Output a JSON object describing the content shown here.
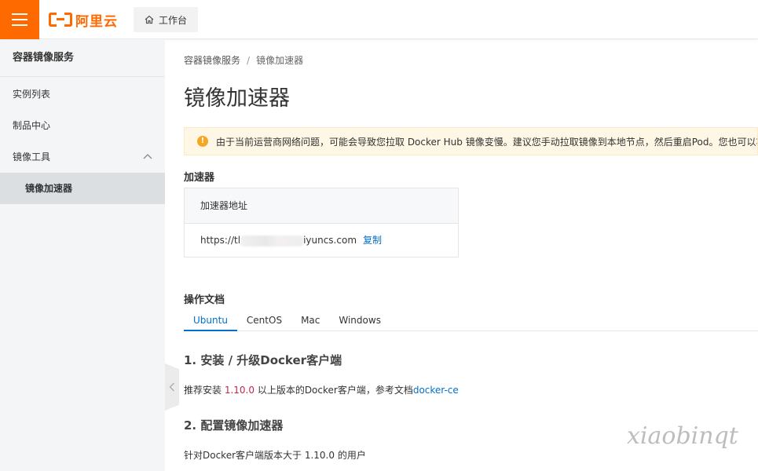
{
  "header": {
    "logo_text": "阿里云",
    "workbench_label": "工作台"
  },
  "sidebar": {
    "title": "容器镜像服务",
    "items": [
      {
        "label": "实例列表"
      },
      {
        "label": "制品中心"
      },
      {
        "label": "镜像工具",
        "expanded": true
      },
      {
        "label": "镜像加速器",
        "active": true
      }
    ]
  },
  "main": {
    "breadcrumb": {
      "parent": "容器镜像服务",
      "separator": "/",
      "current": "镜像加速器"
    },
    "title": "镜像加速器",
    "alert": "由于当前运营商网络问题，可能会导致您拉取 Docker Hub 镜像变慢。建议您手动拉取镜像到本地节点，然后重启Pod。您也可以将",
    "accelerator": {
      "section_title": "加速器",
      "column_header": "加速器地址",
      "url_prefix": "https://tl",
      "url_suffix": "iyuncs.com",
      "copy_label": "复制"
    },
    "docs": {
      "section_title": "操作文档",
      "tabs": [
        {
          "label": "Ubuntu",
          "active": true
        },
        {
          "label": "CentOS"
        },
        {
          "label": "Mac"
        },
        {
          "label": "Windows"
        }
      ],
      "step1": {
        "heading": "1. 安装 / 升级Docker客户端",
        "text_before": "推荐安装 ",
        "version": "1.10.0",
        "text_middle": " 以上版本的Docker客户端，参考文档",
        "link": "docker-ce"
      },
      "step2": {
        "heading": "2. 配置镜像加速器",
        "text": "针对Docker客户端版本大于 1.10.0 的用户"
      }
    }
  },
  "watermark": "xiaobinqt",
  "colors": {
    "brand": "#ff6a00",
    "link": "#0070cc",
    "warning_bg": "#fff7e6"
  }
}
